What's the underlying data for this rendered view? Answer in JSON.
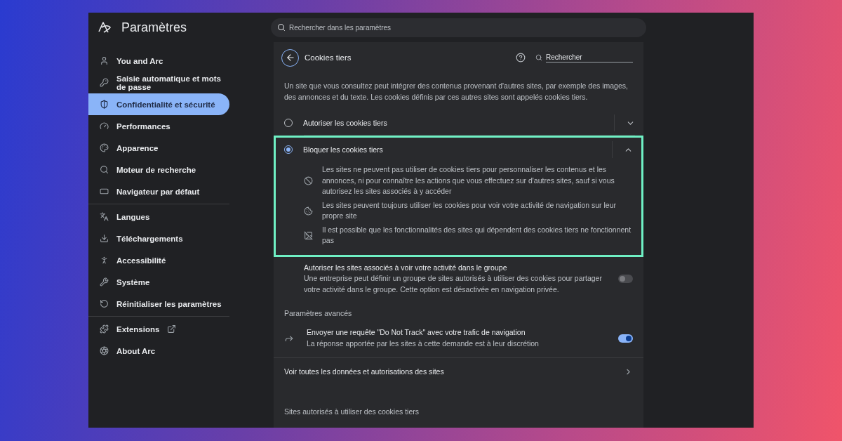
{
  "app": {
    "title": "Paramètres"
  },
  "search": {
    "placeholder": "Rechercher dans les paramètres"
  },
  "sidebar": {
    "sections": [
      {
        "items": [
          {
            "label": "You and Arc",
            "selected": false
          },
          {
            "label": "Saisie automatique et mots de passe",
            "selected": false
          },
          {
            "label": "Confidentialité et sécurité",
            "selected": true
          },
          {
            "label": "Performances",
            "selected": false
          },
          {
            "label": "Apparence",
            "selected": false
          },
          {
            "label": "Moteur de recherche",
            "selected": false
          },
          {
            "label": "Navigateur par défaut",
            "selected": false
          }
        ]
      },
      {
        "items": [
          {
            "label": "Langues",
            "selected": false
          },
          {
            "label": "Téléchargements",
            "selected": false
          },
          {
            "label": "Accessibilité",
            "selected": false
          },
          {
            "label": "Système",
            "selected": false
          },
          {
            "label": "Réinitialiser les paramètres",
            "selected": false
          }
        ]
      },
      {
        "items": [
          {
            "label": "Extensions",
            "selected": false,
            "external": true
          },
          {
            "label": "About Arc",
            "selected": false
          }
        ]
      }
    ]
  },
  "page": {
    "title": "Cookies tiers",
    "search": {
      "placeholder": "Rechercher"
    },
    "description": "Un site que vous consultez peut intégrer des contenus provenant d'autres sites, par exemple des images, des annonces et du texte. Les cookies définis par ces autres sites sont appelés cookies tiers.",
    "options": [
      {
        "label": "Autoriser les cookies tiers",
        "selected": false,
        "expanded": false,
        "highlighted": false
      },
      {
        "label": "Bloquer les cookies tiers",
        "selected": true,
        "expanded": true,
        "highlighted": true,
        "details": [
          "Les sites ne peuvent pas utiliser de cookies tiers pour personnaliser les contenus et les annonces, ni pour connaître les actions que vous effectuez sur d'autres sites, sauf si vous autorisez les sites associés à y accéder",
          "Les sites peuvent toujours utiliser les cookies pour voir votre activité de navigation sur leur propre site",
          "Il est possible que les fonctionnalités des sites qui dépendent des cookies tiers ne fonctionnent pas"
        ]
      }
    ],
    "related_sites": {
      "title": "Autoriser les sites associés à voir votre activité dans le groupe",
      "description": "Une entreprise peut définir un groupe de sites autorisés à utiliser des cookies pour partager votre activité dans le groupe. Cette option est désactivée en navigation privée.",
      "on": false
    },
    "advanced": {
      "heading": "Paramètres avancés",
      "items": [
        {
          "title": "Envoyer une requête \"Do Not Track\" avec votre trafic de navigation",
          "description": "La réponse apportée par les sites à cette demande est à leur discrétion",
          "on": true
        }
      ]
    },
    "site_data_link": {
      "label": "Voir toutes les données et autorisations des sites"
    },
    "allowed_sites": {
      "heading": "Sites autorisés à utiliser des cookies tiers"
    }
  }
}
